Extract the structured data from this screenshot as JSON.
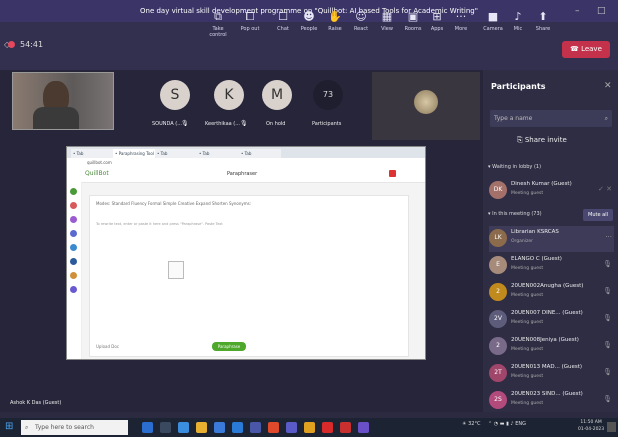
{
  "window": {
    "title": "One day virtual skill development programme on \"Quillbot: AI based Tools for Academic Writing\"",
    "minimize": "–",
    "maximize": "□"
  },
  "meeting": {
    "timer": "54:41"
  },
  "toolbar": {
    "items": [
      {
        "label": "Take control",
        "icon": "screen-share-icon",
        "glyph": "⧉"
      },
      {
        "label": "Pop out",
        "icon": "pop-out-icon",
        "glyph": "⧠"
      },
      {
        "label": "Chat",
        "icon": "chat-icon",
        "glyph": "☐"
      },
      {
        "label": "People",
        "icon": "people-icon",
        "glyph": "☻"
      },
      {
        "label": "Raise",
        "icon": "raise-hand-icon",
        "glyph": "✋"
      },
      {
        "label": "React",
        "icon": "react-icon",
        "glyph": "☺"
      },
      {
        "label": "View",
        "icon": "view-icon",
        "glyph": "▦"
      },
      {
        "label": "Rooms",
        "icon": "rooms-icon",
        "glyph": "▣"
      },
      {
        "label": "Apps",
        "icon": "apps-icon",
        "glyph": "⊞"
      },
      {
        "label": "More",
        "icon": "more-icon",
        "glyph": "···"
      }
    ],
    "camera": "Camera",
    "mic": "Mic",
    "share": "Share",
    "leave": "Leave"
  },
  "stage": {
    "speaker_name": "Ashok K Das (Guest)",
    "avatars": [
      {
        "initial": "S",
        "label": "SOUNDA (..."
      },
      {
        "initial": "K",
        "label": "Keerthikaa (..."
      },
      {
        "initial": "M",
        "label": "On hold"
      },
      {
        "initial": "73",
        "label": "Participants"
      }
    ]
  },
  "shared_screen": {
    "url": "quillbot.com",
    "app_name": "QuillBot",
    "page_title": "Paraphraser",
    "modes": "Modes:  Standard  Fluency  Formal  Simple  Creative  Expand  Shorten  Synonyms:",
    "placeholder": "To rewrite text, enter or paste it here and press \"Paraphrase\". Paste Text",
    "upload": "Upload Doc",
    "paraphrase_button": "Paraphrase"
  },
  "participants": {
    "title": "Participants",
    "search_placeholder": "Type a name",
    "share_invite": "Share invite",
    "lobby_header": "Waiting in lobby (1)",
    "lobby": [
      {
        "initials": "DK",
        "name": "Dinesh Kumar (Guest)",
        "status": "Meeting guest",
        "color": "#a4716a"
      }
    ],
    "meeting_header": "In this meeting (73)",
    "mute_all": "Mute all",
    "members": [
      {
        "initials": "LK",
        "name": "Librarian KSRCAS",
        "status": "Organizer",
        "color": "#8c6b4c"
      },
      {
        "initials": "E",
        "name": "ELANGO C (Guest)",
        "status": "Meeting guest",
        "color": "#a68b7a"
      },
      {
        "initials": "2",
        "name": "20UEN002Anugha (Guest)",
        "status": "Meeting guest",
        "color": "#c08a1c"
      },
      {
        "initials": "2V",
        "name": "20UEN007 DINE... (Guest)",
        "status": "Meeting guest",
        "color": "#5d5c7a"
      },
      {
        "initials": "2",
        "name": "20UEN008Jeniya (Guest)",
        "status": "Meeting guest",
        "color": "#7a6a8a"
      },
      {
        "initials": "2T",
        "name": "20UEN013 MAD... (Guest)",
        "status": "Meeting guest",
        "color": "#a0466a"
      },
      {
        "initials": "2S",
        "name": "20UEN023 SIND... (Guest)",
        "status": "Meeting guest",
        "color": "#b34a7c"
      }
    ]
  },
  "taskbar": {
    "search": "Type here to search",
    "temp": "32°C",
    "time": "11:50 AM",
    "date": "01-04-2023"
  }
}
